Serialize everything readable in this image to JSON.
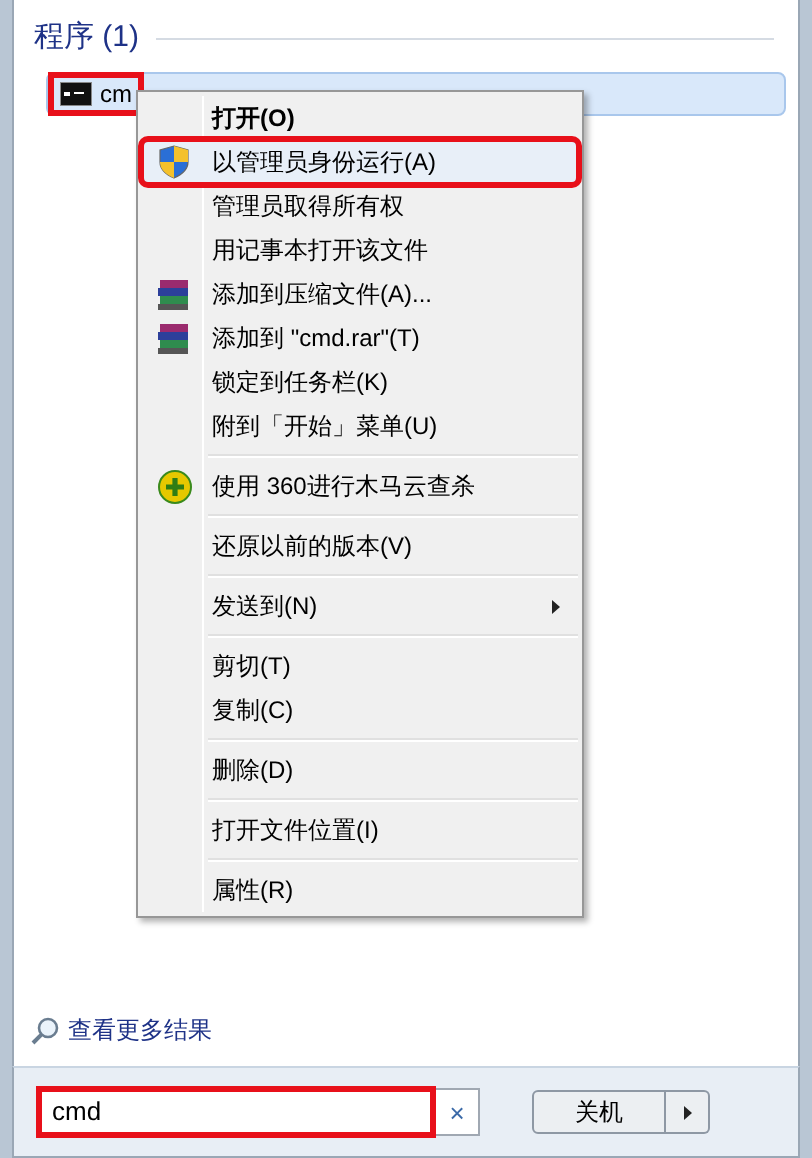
{
  "section": {
    "title": "程序 (1)"
  },
  "results": [
    {
      "label": "cm",
      "selected": true,
      "outlined": true
    }
  ],
  "context_menu": {
    "items": [
      {
        "kind": "plain",
        "label": "打开(O)",
        "bold": true,
        "selected": false,
        "outlined": false
      },
      {
        "kind": "shield",
        "label": "以管理员身份运行(A)",
        "bold": false,
        "selected": true,
        "outlined": true
      },
      {
        "kind": "plain",
        "label": "管理员取得所有权",
        "bold": false,
        "selected": false,
        "outlined": false
      },
      {
        "kind": "plain",
        "label": "用记事本打开该文件",
        "bold": false,
        "selected": false,
        "outlined": false
      },
      {
        "kind": "archive",
        "label": "添加到压缩文件(A)...",
        "bold": false,
        "selected": false,
        "outlined": false
      },
      {
        "kind": "archive",
        "label": "添加到 \"cmd.rar\"(T)",
        "bold": false,
        "selected": false,
        "outlined": false
      },
      {
        "kind": "plain",
        "label": "锁定到任务栏(K)",
        "bold": false,
        "selected": false,
        "outlined": false
      },
      {
        "kind": "plain",
        "label": "附到「开始」菜单(U)",
        "bold": false,
        "selected": false,
        "outlined": false
      },
      {
        "kind": "separator"
      },
      {
        "kind": "scan",
        "label": "使用 360进行木马云查杀",
        "bold": false,
        "selected": false,
        "outlined": false
      },
      {
        "kind": "separator"
      },
      {
        "kind": "plain",
        "label": "还原以前的版本(V)",
        "bold": false,
        "selected": false,
        "outlined": false
      },
      {
        "kind": "separator"
      },
      {
        "kind": "submenu",
        "label": "发送到(N)",
        "bold": false,
        "selected": false,
        "outlined": false
      },
      {
        "kind": "separator"
      },
      {
        "kind": "plain",
        "label": "剪切(T)",
        "bold": false,
        "selected": false,
        "outlined": false
      },
      {
        "kind": "plain",
        "label": "复制(C)",
        "bold": false,
        "selected": false,
        "outlined": false
      },
      {
        "kind": "separator"
      },
      {
        "kind": "plain",
        "label": "删除(D)",
        "bold": false,
        "selected": false,
        "outlined": false
      },
      {
        "kind": "separator"
      },
      {
        "kind": "plain",
        "label": "打开文件位置(I)",
        "bold": false,
        "selected": false,
        "outlined": false
      },
      {
        "kind": "separator"
      },
      {
        "kind": "plain",
        "label": "属性(R)",
        "bold": false,
        "selected": false,
        "outlined": false
      }
    ]
  },
  "more_results": {
    "label": "查看更多结果"
  },
  "search": {
    "value": "cmd",
    "clear": "×",
    "outlined": true
  },
  "shutdown": {
    "label": "关机"
  }
}
